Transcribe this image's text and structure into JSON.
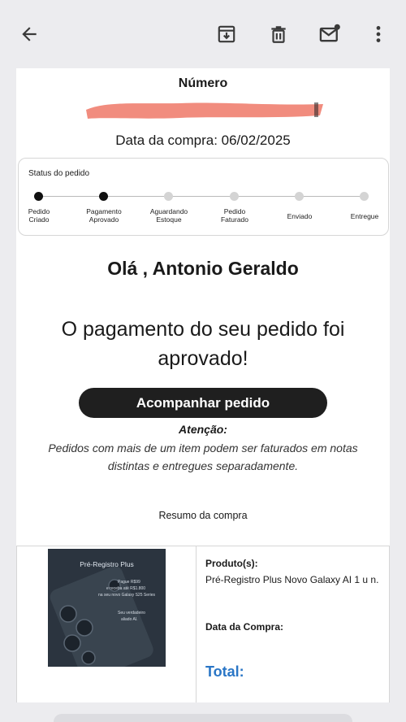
{
  "toolbar": {
    "icons": [
      "arrow-back-icon",
      "archive-icon",
      "delete-icon",
      "mark-unread-icon",
      "more-vert-icon"
    ]
  },
  "order": {
    "number_label": "Número",
    "date_line": "Data da compra: 06/02/2025"
  },
  "status": {
    "title": "Status do pedido",
    "steps": [
      {
        "label_1": "Pedido",
        "label_2": "Criado",
        "done": true
      },
      {
        "label_1": "Pagamento",
        "label_2": "Aprovado",
        "done": true
      },
      {
        "label_1": "Aguardando",
        "label_2": "Estoque",
        "done": false
      },
      {
        "label_1": "Pedido",
        "label_2": "Faturado",
        "done": false
      },
      {
        "label_1": "Enviado",
        "label_2": "",
        "done": false
      },
      {
        "label_1": "Entregue",
        "label_2": "",
        "done": false
      }
    ]
  },
  "message": {
    "greeting": "Olá , Antonio Geraldo",
    "headline_1": "O pagamento do seu pedido foi",
    "headline_2": "aprovado!",
    "cta_label": "Acompanhar pedido",
    "attention_title": "Atenção:",
    "attention_line_1": "Pedidos com mais de um item podem ser faturados em notas",
    "attention_line_2": "distintas e entregues separadamente."
  },
  "summary": {
    "title": "Resumo da compra",
    "image": {
      "title": "Pré-Registro Plus",
      "line_1": "Pague R$99",
      "line_2": "e receba até R$1.800",
      "line_3": "na seu novo Galaxy S25 Series",
      "line_4": "Seu verdadeiro",
      "line_5": "aliado AI."
    },
    "product_label": "Produto(s):",
    "product_value": "Pré-Registro Plus Novo Galaxy AI 1 u n.",
    "date_label": "Data da Compra:",
    "total_label": "Total:"
  },
  "colors": {
    "accent": "#2a76c6",
    "done_dot": "#111111",
    "pending_dot": "#d4d4d4",
    "redaction": "#f08070"
  }
}
